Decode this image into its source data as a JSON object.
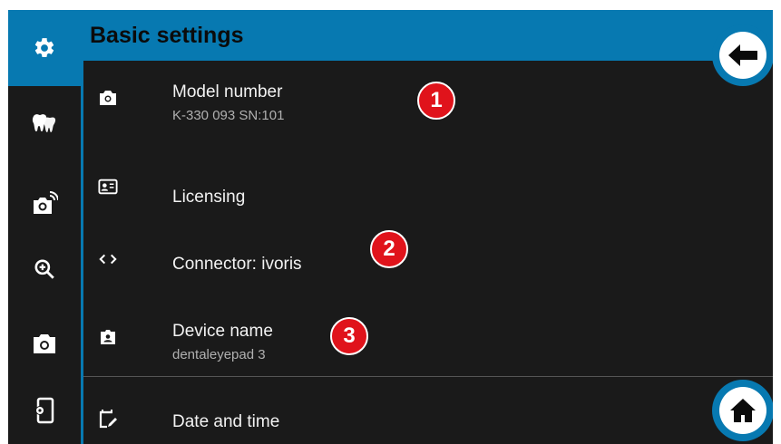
{
  "header": {
    "title": "Basic settings"
  },
  "sidebar": {
    "items": [
      {
        "icon": "gear-icon",
        "active": true
      },
      {
        "icon": "teeth-icon",
        "active": false
      },
      {
        "icon": "wireless-camera-icon",
        "active": false
      },
      {
        "icon": "zoom-in-icon",
        "active": false
      },
      {
        "icon": "camera-icon",
        "active": false
      },
      {
        "icon": "device-settings-icon",
        "active": false
      }
    ]
  },
  "settings": {
    "model": {
      "label": "Model number",
      "value": "K-330 093 SN:101",
      "icon": "camera-icon"
    },
    "licensing": {
      "label": "Licensing",
      "icon": "license-card-icon"
    },
    "connector": {
      "label": "Connector: ivoris",
      "icon": "code-brackets-icon"
    },
    "device": {
      "label": "Device name",
      "value": "dentaleyepad 3",
      "icon": "contact-badge-icon"
    },
    "datetime": {
      "label": "Date and time",
      "icon": "calendar-edit-icon"
    }
  },
  "annotations": {
    "badge1": "1",
    "badge2": "2",
    "badge3": "3"
  },
  "buttons": {
    "back": "back-arrow-icon",
    "home": "home-icon"
  },
  "colors": {
    "accent": "#0779b1",
    "background": "#1a1a1a",
    "badge": "#e0131b",
    "text": "#f2f2f2",
    "subtext": "#b0b0b0"
  }
}
